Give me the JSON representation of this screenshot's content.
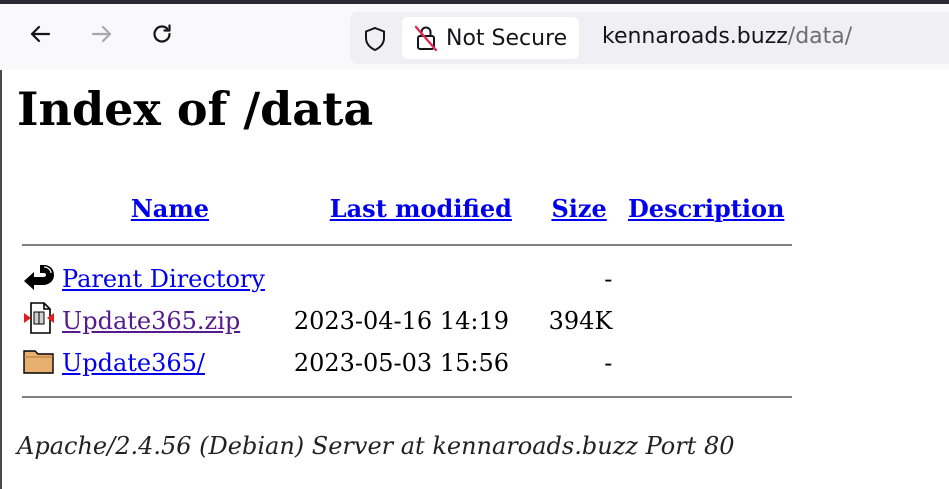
{
  "browser": {
    "security_label": "Not Secure",
    "url_host": "kennaroads.buzz",
    "url_path": "/data/"
  },
  "page": {
    "title": "Index of /data",
    "columns": {
      "name": "Name",
      "last_modified": "Last modified",
      "size": "Size",
      "description": "Description"
    },
    "rows": [
      {
        "icon": "back-icon",
        "name": "Parent Directory",
        "modified": "",
        "size": "-"
      },
      {
        "icon": "compressed-file-icon",
        "name": "Update365.zip",
        "modified": "2023-04-16 14:19",
        "size": "394K"
      },
      {
        "icon": "folder-icon",
        "name": "Update365/",
        "modified": "2023-05-03 15:56",
        "size": "-"
      }
    ],
    "address": "Apache/2.4.56 (Debian) Server at kennaroads.buzz Port 80"
  }
}
